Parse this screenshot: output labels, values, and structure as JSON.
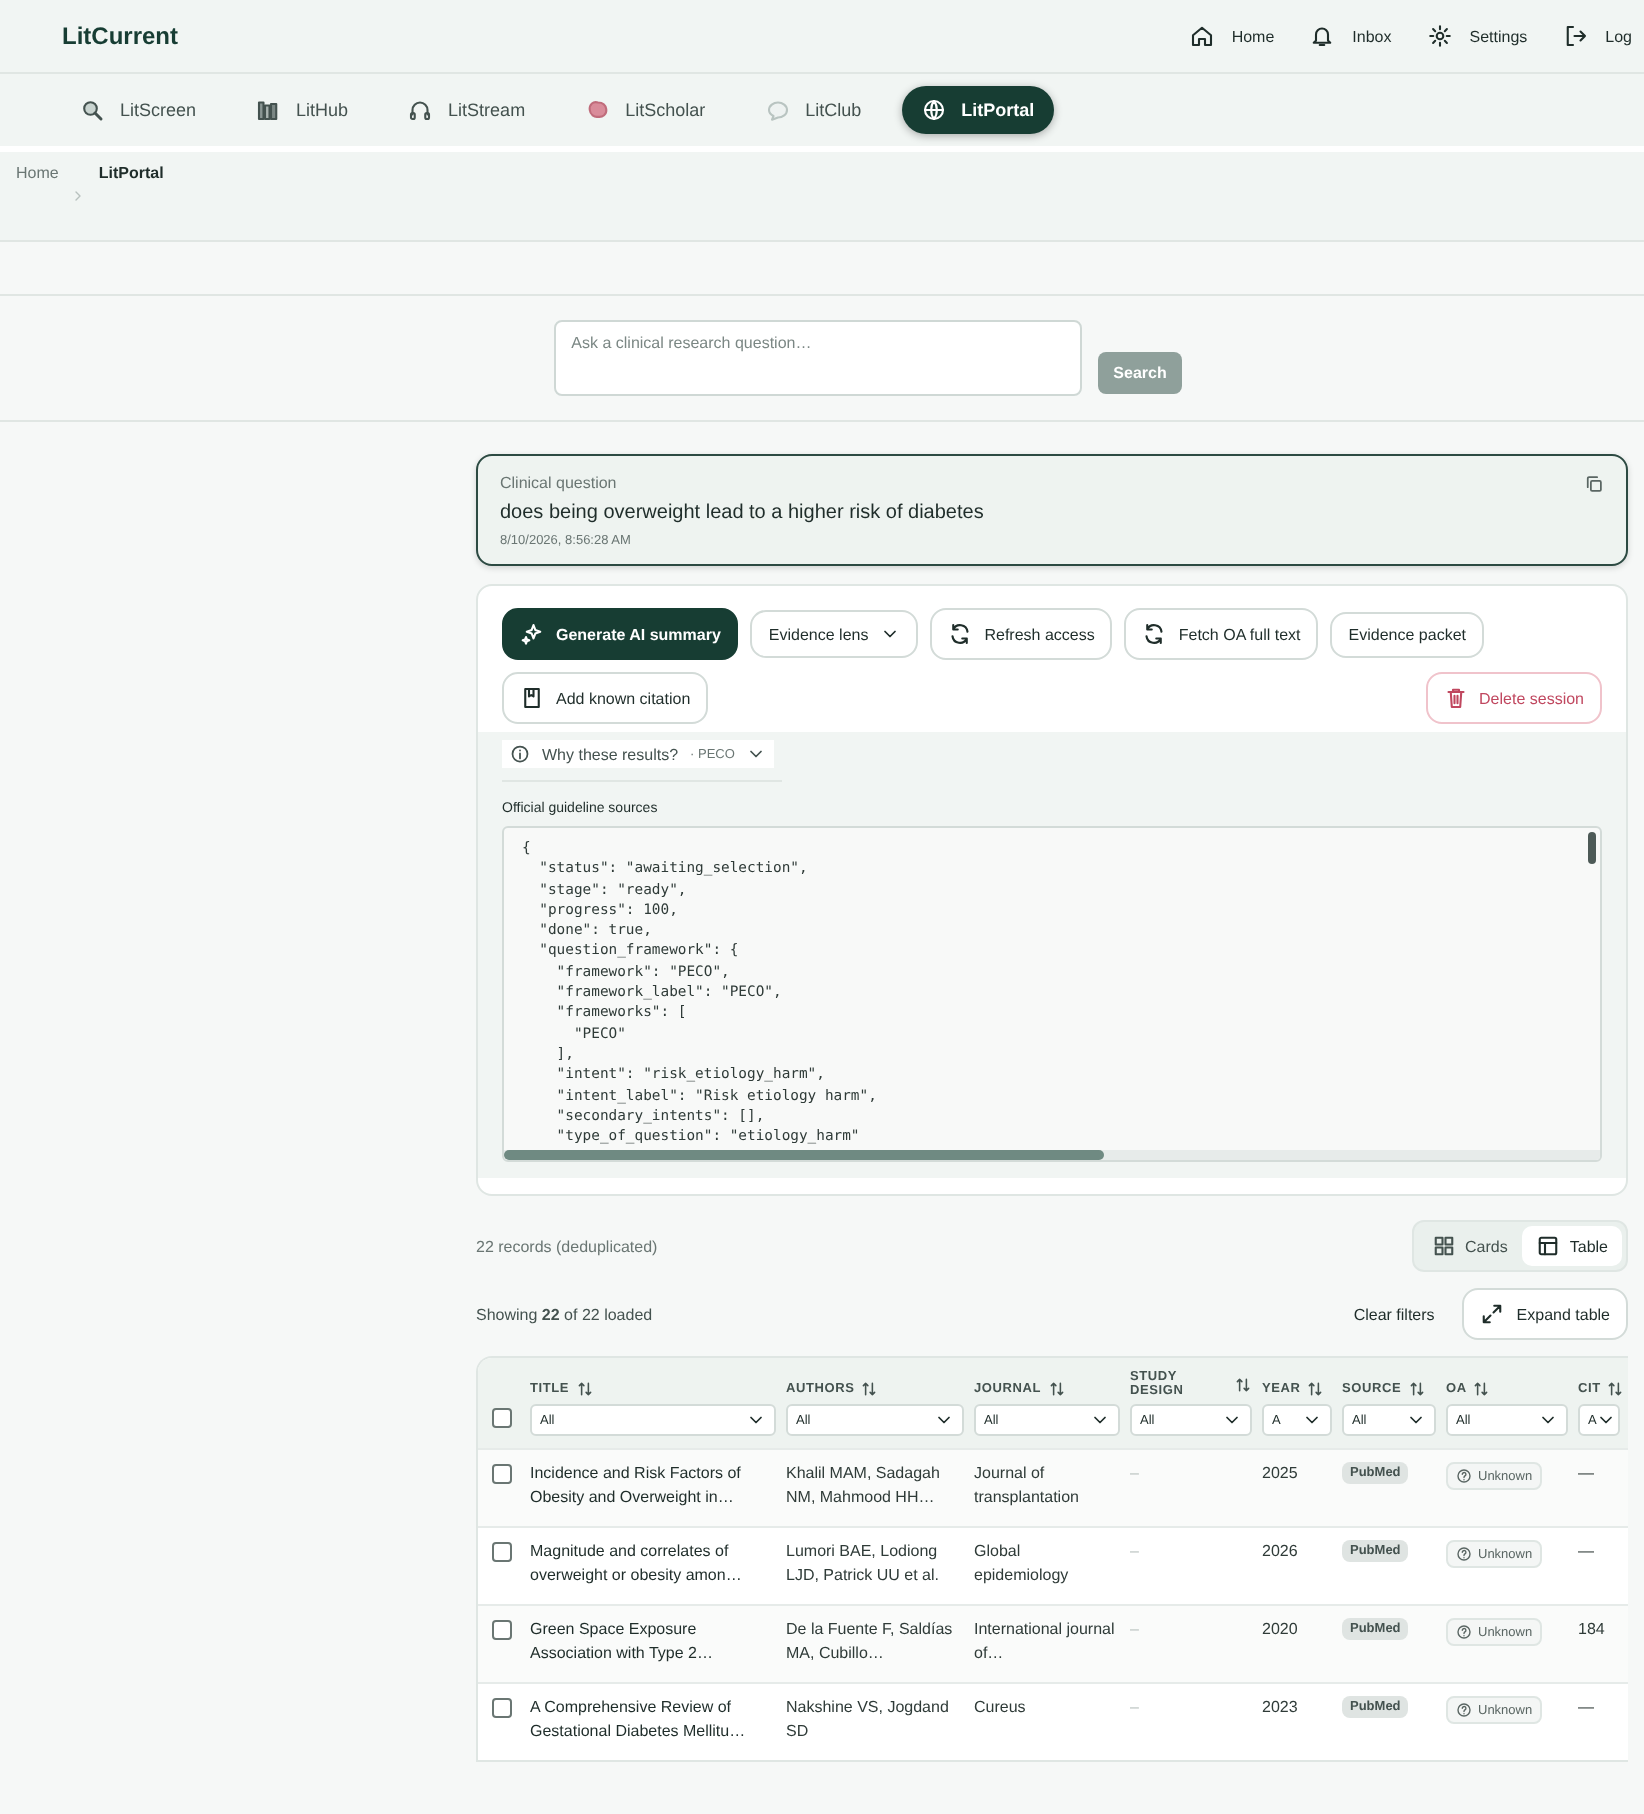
{
  "app": {
    "title": "LitCurrent"
  },
  "top_nav": [
    {
      "label": "Home"
    },
    {
      "label": "Inbox"
    },
    {
      "label": "Settings"
    },
    {
      "label": "Log"
    }
  ],
  "products": [
    {
      "label": "LitScreen",
      "selected": false
    },
    {
      "label": "LitHub",
      "selected": false
    },
    {
      "label": "LitStream",
      "selected": false
    },
    {
      "label": "LitScholar",
      "selected": false
    },
    {
      "label": "LitClub",
      "selected": false
    },
    {
      "label": "LitPortal",
      "selected": true
    }
  ],
  "breadcrumb": [
    "Home",
    "LitPortal"
  ],
  "search": {
    "placeholder": "Ask a clinical research question…",
    "button": "Search"
  },
  "question": {
    "label": "Clinical question",
    "text": "does being overweight lead to a higher risk of diabetes",
    "timestamp": "8/10/2026, 8:56:28 AM"
  },
  "actions": [
    {
      "label": "Generate AI summary",
      "kind": "primary"
    },
    {
      "label": "Evidence lens",
      "kind": "dropdown"
    },
    {
      "label": "Refresh access",
      "kind": "refresh"
    },
    {
      "label": "Fetch OA full text",
      "kind": "refresh"
    },
    {
      "label": "Evidence packet",
      "kind": "plain"
    },
    {
      "label": "Add known citation",
      "kind": "book"
    }
  ],
  "delete_button": "Delete session",
  "why": {
    "label": "Why these results?",
    "tag": "· PECO"
  },
  "guideline": {
    "label": "Official guideline sources",
    "code_lines": [
      "{",
      "  \"status\": \"awaiting_selection\",",
      "  \"stage\": \"ready\",",
      "  \"progress\": 100,",
      "  \"done\": true,",
      "  \"question_framework\": {",
      "    \"framework\": \"PECO\",",
      "    \"framework_label\": \"PECO\",",
      "    \"frameworks\": [",
      "      \"PECO\"",
      "    ],",
      "    \"intent\": \"risk_etiology_harm\",",
      "    \"intent_label\": \"Risk etiology harm\",",
      "    \"secondary_intents\": [],",
      "    \"type_of_question\": \"etiology_harm\""
    ]
  },
  "records_count": "22 records (deduplicated)",
  "views": [
    {
      "label": "Cards",
      "selected": false
    },
    {
      "label": "Table",
      "selected": true
    }
  ],
  "showing": "Showing **22** of 22 loaded",
  "clear_filters": "Clear filters",
  "expand_table": "Expand table",
  "table": {
    "select_all": {
      "selected": false
    },
    "columns": [
      {
        "label": "TITLE",
        "filter": "All"
      },
      {
        "label": "AUTHORS",
        "filter": "All"
      },
      {
        "label": "JOURNAL",
        "filter": "All"
      },
      {
        "label": "STUDY DESIGN",
        "filter": "All"
      },
      {
        "label": "YEAR",
        "filter": "A"
      },
      {
        "label": "SOURCE",
        "filter": "All"
      },
      {
        "label": "OA",
        "filter": "All"
      },
      {
        "label": "CIT",
        "filter": "A"
      }
    ],
    "rows": [
      {
        "selected": false,
        "cells": [
          "Incidence and Risk Factors of Obesity and Overweight in…",
          "Khalil MAM, Sadagah NM, Mahmood HH…",
          "Journal of transplantation",
          "–",
          "2025",
          "PubMed",
          "Unknown",
          "—"
        ]
      },
      {
        "selected": false,
        "cells": [
          "Magnitude and correlates of overweight or obesity amon…",
          "Lumori BAE, Lodiong LJD, Patrick UU et al.",
          "Global epidemiology",
          "–",
          "2026",
          "PubMed",
          "Unknown",
          "—"
        ]
      },
      {
        "selected": false,
        "cells": [
          "Green Space Exposure Association with Type 2…",
          "De la Fuente F, Saldías MA, Cubillo…",
          "International journal of…",
          "–",
          "2020",
          "PubMed",
          "Unknown",
          "184"
        ]
      },
      {
        "selected": false,
        "cells": [
          "A Comprehensive Review of Gestational Diabetes Mellitu…",
          "Nakshine VS, Jogdand SD",
          "Cureus",
          "–",
          "2023",
          "PubMed",
          "Unknown",
          "—"
        ]
      }
    ]
  }
}
